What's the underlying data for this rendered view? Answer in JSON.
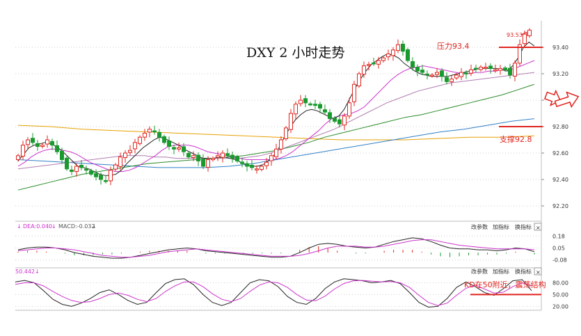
{
  "chart_data": {
    "type": "line",
    "title": "DXY  2 小时走势",
    "main_panel": {
      "y_ticks": [
        "93.40",
        "93.20",
        "93.00",
        "92.80",
        "92.60",
        "92.40",
        "92.20"
      ],
      "ylim": [
        92.1,
        93.6
      ],
      "grid": true,
      "high_label": "93.53",
      "close": [
        92.58,
        92.66,
        92.7,
        92.68,
        92.65,
        92.66,
        92.7,
        92.66,
        92.61,
        92.55,
        92.48,
        92.46,
        92.5,
        92.49,
        92.47,
        92.44,
        92.42,
        92.4,
        92.39,
        92.47,
        92.51,
        92.57,
        92.6,
        92.62,
        92.68,
        92.72,
        92.75,
        92.78,
        92.76,
        92.72,
        92.68,
        92.65,
        92.63,
        92.64,
        92.61,
        92.57,
        92.58,
        92.54,
        92.5,
        92.55,
        92.56,
        92.58,
        92.6,
        92.58,
        92.56,
        92.54,
        92.52,
        92.5,
        92.49,
        92.48,
        92.5,
        92.53,
        92.58,
        92.63,
        92.7,
        92.79,
        92.9,
        92.97,
        93.0,
        92.98,
        92.97,
        92.96,
        92.94,
        92.91,
        92.86,
        92.84,
        92.82,
        92.88,
        92.98,
        93.12,
        93.2,
        93.26,
        93.27,
        93.28,
        93.3,
        93.32,
        93.35,
        93.38,
        93.42,
        93.37,
        93.3,
        93.25,
        93.22,
        93.21,
        93.19,
        93.19,
        93.21,
        93.18,
        93.14,
        93.16,
        93.19,
        93.21,
        93.2,
        93.23,
        93.24,
        93.25,
        93.25,
        93.24,
        93.23,
        93.24,
        93.23,
        93.19,
        93.28,
        93.42,
        93.5,
        93.53
      ],
      "ma5": [
        92.54,
        92.59,
        92.64,
        92.66,
        92.67,
        92.68,
        92.67,
        92.65,
        92.62,
        92.58,
        92.54,
        92.5,
        92.49,
        92.48,
        92.46,
        92.44,
        92.43,
        92.43,
        92.44,
        92.47,
        92.52,
        92.56,
        92.6,
        92.64,
        92.67,
        92.7,
        92.72,
        92.71,
        92.69,
        92.67,
        92.65,
        92.62,
        92.6,
        92.58,
        92.56,
        92.56,
        92.56,
        92.57,
        92.57,
        92.56,
        92.55,
        92.53,
        92.51,
        92.5,
        92.5,
        92.51,
        92.54,
        92.58,
        92.64,
        92.72,
        92.79,
        92.85,
        92.89,
        92.92,
        92.93,
        92.92,
        92.9,
        92.88,
        92.86,
        92.88,
        92.93,
        93.01,
        93.09,
        93.16,
        93.22,
        93.27,
        93.3,
        93.33,
        93.35,
        93.34,
        93.32,
        93.28,
        93.25,
        93.22,
        93.2,
        93.19,
        93.18,
        93.18,
        93.18,
        93.18,
        93.19,
        93.2,
        93.21,
        93.22,
        93.23,
        93.24,
        93.24,
        93.24,
        93.24,
        93.23,
        93.22,
        93.26,
        93.32,
        93.4,
        93.44,
        93.41
      ],
      "ma10": [
        92.5,
        92.53,
        92.57,
        92.6,
        92.62,
        92.63,
        92.63,
        92.62,
        92.61,
        92.59,
        92.56,
        92.53,
        92.51,
        92.49,
        92.47,
        92.46,
        92.46,
        92.47,
        92.49,
        92.52,
        92.55,
        92.58,
        92.62,
        92.65,
        92.66,
        92.66,
        92.66,
        92.65,
        92.63,
        92.61,
        92.6,
        92.59,
        92.58,
        92.57,
        92.56,
        92.55,
        92.55,
        92.55,
        92.55,
        92.55,
        92.56,
        92.58,
        92.61,
        92.65,
        92.69,
        92.73,
        92.77,
        92.82,
        92.86,
        92.88,
        92.89,
        92.9,
        92.92,
        92.95,
        93.0,
        93.05,
        93.1,
        93.15,
        93.19,
        93.22,
        93.24,
        93.25,
        93.26,
        93.25,
        93.24,
        93.23,
        93.22,
        93.21,
        93.2,
        93.2,
        93.21,
        93.21,
        93.22,
        93.22,
        93.23,
        93.23,
        93.24,
        93.26,
        93.28,
        93.3
      ],
      "ma30": [
        92.48,
        92.49,
        92.5,
        92.51,
        92.52,
        92.53,
        92.54,
        92.55,
        92.56,
        92.57,
        92.58,
        92.58,
        92.58,
        92.57,
        92.57,
        92.56,
        92.56,
        92.56,
        92.56,
        92.56,
        92.56,
        92.56,
        92.57,
        92.58,
        92.6,
        92.63,
        92.66,
        92.69,
        92.72,
        92.75,
        92.78,
        92.82,
        92.86,
        92.9,
        92.94,
        92.98,
        93.01,
        93.04,
        93.07,
        93.09,
        93.11,
        93.13,
        93.14,
        93.15,
        93.16,
        93.17,
        93.18,
        93.19,
        93.2,
        93.21
      ],
      "ma60": [
        92.32,
        92.35,
        92.38,
        92.41,
        92.44,
        92.46,
        92.48,
        92.5,
        92.52,
        92.53,
        92.54,
        92.55,
        92.56,
        92.57,
        92.58,
        92.6,
        92.62,
        92.65,
        92.68,
        92.72,
        92.75,
        92.78,
        92.81,
        92.84,
        92.87,
        92.89,
        92.92,
        92.95,
        92.98,
        93.01,
        93.04,
        93.08,
        93.12
      ],
      "ma120": [
        92.55,
        92.54,
        92.53,
        92.52,
        92.51,
        92.5,
        92.49,
        92.49,
        92.49,
        92.5,
        92.52,
        92.55,
        92.58,
        92.61,
        92.64,
        92.67,
        92.7,
        92.73,
        92.76,
        92.78,
        92.81,
        92.84,
        92.86
      ],
      "ma250": [
        92.81,
        92.8,
        92.78,
        92.77,
        92.76,
        92.75,
        92.74,
        92.73,
        92.72,
        92.71,
        92.7,
        92.7,
        92.7,
        92.71,
        92.72,
        92.72,
        92.73
      ],
      "annotations": [
        {
          "text": "压力93.4",
          "level": 93.4
        },
        {
          "text": "支撑92.8",
          "level": 92.8
        }
      ]
    },
    "macd_panel": {
      "header": "DEA:0.040",
      "header2": "MACD:-0.032",
      "y_ticks": [
        "0.18",
        "0.05",
        "-0.08"
      ],
      "ylim": [
        -0.12,
        0.22
      ],
      "dif": [
        0.03,
        0.05,
        0.06,
        0.06,
        0.05,
        0.03,
        0.0,
        -0.02,
        -0.04,
        -0.05,
        -0.06,
        -0.06,
        -0.05,
        -0.03,
        -0.01,
        0.01,
        0.03,
        0.04,
        0.05,
        0.04,
        0.02,
        0.01,
        0.0,
        -0.01,
        -0.02,
        -0.03,
        -0.04,
        -0.05,
        -0.05,
        -0.04,
        0.0,
        0.05,
        0.09,
        0.1,
        0.09,
        0.07,
        0.06,
        0.05,
        0.06,
        0.09,
        0.12,
        0.14,
        0.16,
        0.15,
        0.12,
        0.08,
        0.05,
        0.04,
        0.04,
        0.03,
        0.03,
        0.02,
        0.03,
        0.05,
        0.04,
        0.01
      ],
      "dea": [
        0.02,
        0.03,
        0.04,
        0.05,
        0.05,
        0.04,
        0.03,
        0.01,
        -0.01,
        -0.03,
        -0.04,
        -0.05,
        -0.05,
        -0.04,
        -0.03,
        -0.01,
        0.01,
        0.02,
        0.03,
        0.04,
        0.03,
        0.02,
        0.01,
        0.0,
        -0.01,
        -0.02,
        -0.03,
        -0.04,
        -0.04,
        -0.04,
        -0.03,
        -0.01,
        0.02,
        0.05,
        0.07,
        0.07,
        0.07,
        0.06,
        0.06,
        0.07,
        0.09,
        0.11,
        0.13,
        0.14,
        0.14,
        0.12,
        0.1,
        0.08,
        0.07,
        0.06,
        0.05,
        0.04,
        0.04,
        0.04,
        0.04,
        0.03
      ],
      "hist": [
        0.01,
        0.02,
        0.02,
        0.01,
        0.0,
        -0.01,
        -0.03,
        -0.03,
        -0.03,
        -0.02,
        -0.02,
        -0.01,
        0.0,
        0.01,
        0.02,
        0.02,
        0.02,
        0.02,
        0.02,
        0.0,
        -0.01,
        -0.01,
        -0.01,
        -0.01,
        -0.01,
        -0.01,
        -0.01,
        -0.01,
        -0.01,
        0.0,
        0.03,
        0.06,
        0.07,
        0.05,
        0.02,
        0.0,
        -0.01,
        -0.01,
        0.0,
        0.02,
        0.03,
        0.03,
        0.03,
        0.01,
        -0.02,
        -0.04,
        -0.05,
        -0.04,
        -0.03,
        -0.03,
        -0.02,
        -0.02,
        -0.01,
        0.01,
        0.0,
        -0.02
      ]
    },
    "kd_panel": {
      "header": "50.442",
      "y_ticks": [
        "80.00",
        "50.00",
        "20.00"
      ],
      "ylim": [
        10,
        95
      ],
      "k": [
        82,
        86,
        80,
        60,
        38,
        25,
        20,
        28,
        40,
        55,
        62,
        50,
        35,
        25,
        30,
        55,
        78,
        88,
        90,
        75,
        50,
        30,
        22,
        30,
        55,
        80,
        88,
        85,
        70,
        45,
        30,
        25,
        40,
        65,
        82,
        90,
        88,
        85,
        80,
        82,
        86,
        78,
        55,
        30,
        18,
        20,
        40,
        68,
        82,
        70,
        55,
        48,
        65,
        85,
        88,
        60
      ],
      "d": [
        76,
        80,
        80,
        72,
        58,
        45,
        35,
        30,
        32,
        40,
        50,
        54,
        48,
        38,
        32,
        40,
        58,
        72,
        82,
        82,
        70,
        52,
        38,
        32,
        40,
        58,
        74,
        82,
        80,
        68,
        50,
        36,
        34,
        46,
        64,
        78,
        85,
        86,
        84,
        82,
        83,
        80,
        68,
        48,
        30,
        22,
        28,
        48,
        66,
        74,
        64,
        54,
        56,
        70,
        80,
        72
      ],
      "annotation": {
        "text": "KD在50附近，震荡结构",
        "level": 50
      }
    }
  },
  "ui": {
    "btn_params": "改参数",
    "btn_add": "加指标",
    "btn_switch": "换指标",
    "close_glyph": "×",
    "down_arrow": "↓",
    "colors": {
      "up": "#e0231e",
      "down": "#1a9a2e",
      "ma5": "#222222",
      "ma10": "#cc33cc",
      "ma30": "#b07cb0",
      "ma60": "#2a8a2a",
      "ma120": "#2f7ec5",
      "ma250": "#e6a100",
      "red": "#e0231e",
      "grid": "#cfcfcf",
      "border": "#bdbdbd",
      "arrow": "#e0231e"
    }
  }
}
